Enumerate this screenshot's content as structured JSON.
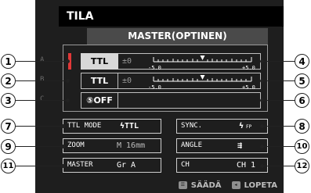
{
  "screen_title": "TILA",
  "mode_header": "MASTER(OPTINEN)",
  "groups": [
    {
      "id": "A",
      "mode": "TTL",
      "value": "±0",
      "scale_min": "-5.0",
      "scale_max": "+5.0",
      "selected": true
    },
    {
      "id": "B",
      "mode": "TTL",
      "value": "±0",
      "scale_min": "-5.0",
      "scale_max": "+5.0",
      "selected": false
    },
    {
      "id": "C",
      "mode": "⑤OFF",
      "value": "",
      "selected": false
    }
  ],
  "settings": {
    "ttl_mode": {
      "label": "TTL MODE",
      "value": "ϟTTL"
    },
    "sync": {
      "label": "SYNC.",
      "value": "ϟ",
      "sub": "FP"
    },
    "zoom": {
      "label": "ZOOM",
      "value": "M 16mm"
    },
    "angle": {
      "label": "ANGLE",
      "value": "⇶"
    },
    "master": {
      "label": "MASTER",
      "value": "Gr A"
    },
    "channel": {
      "label": "CH",
      "value": "CH 1"
    }
  },
  "footer": {
    "adjust_icon": "menu-icon",
    "adjust_label": "SÄÄDÄ",
    "exit_icon": "back-icon",
    "exit_label": "LOPETA"
  },
  "callouts": [
    "1",
    "2",
    "3",
    "4",
    "5",
    "6",
    "7",
    "8",
    "9",
    "10",
    "11",
    "12"
  ]
}
